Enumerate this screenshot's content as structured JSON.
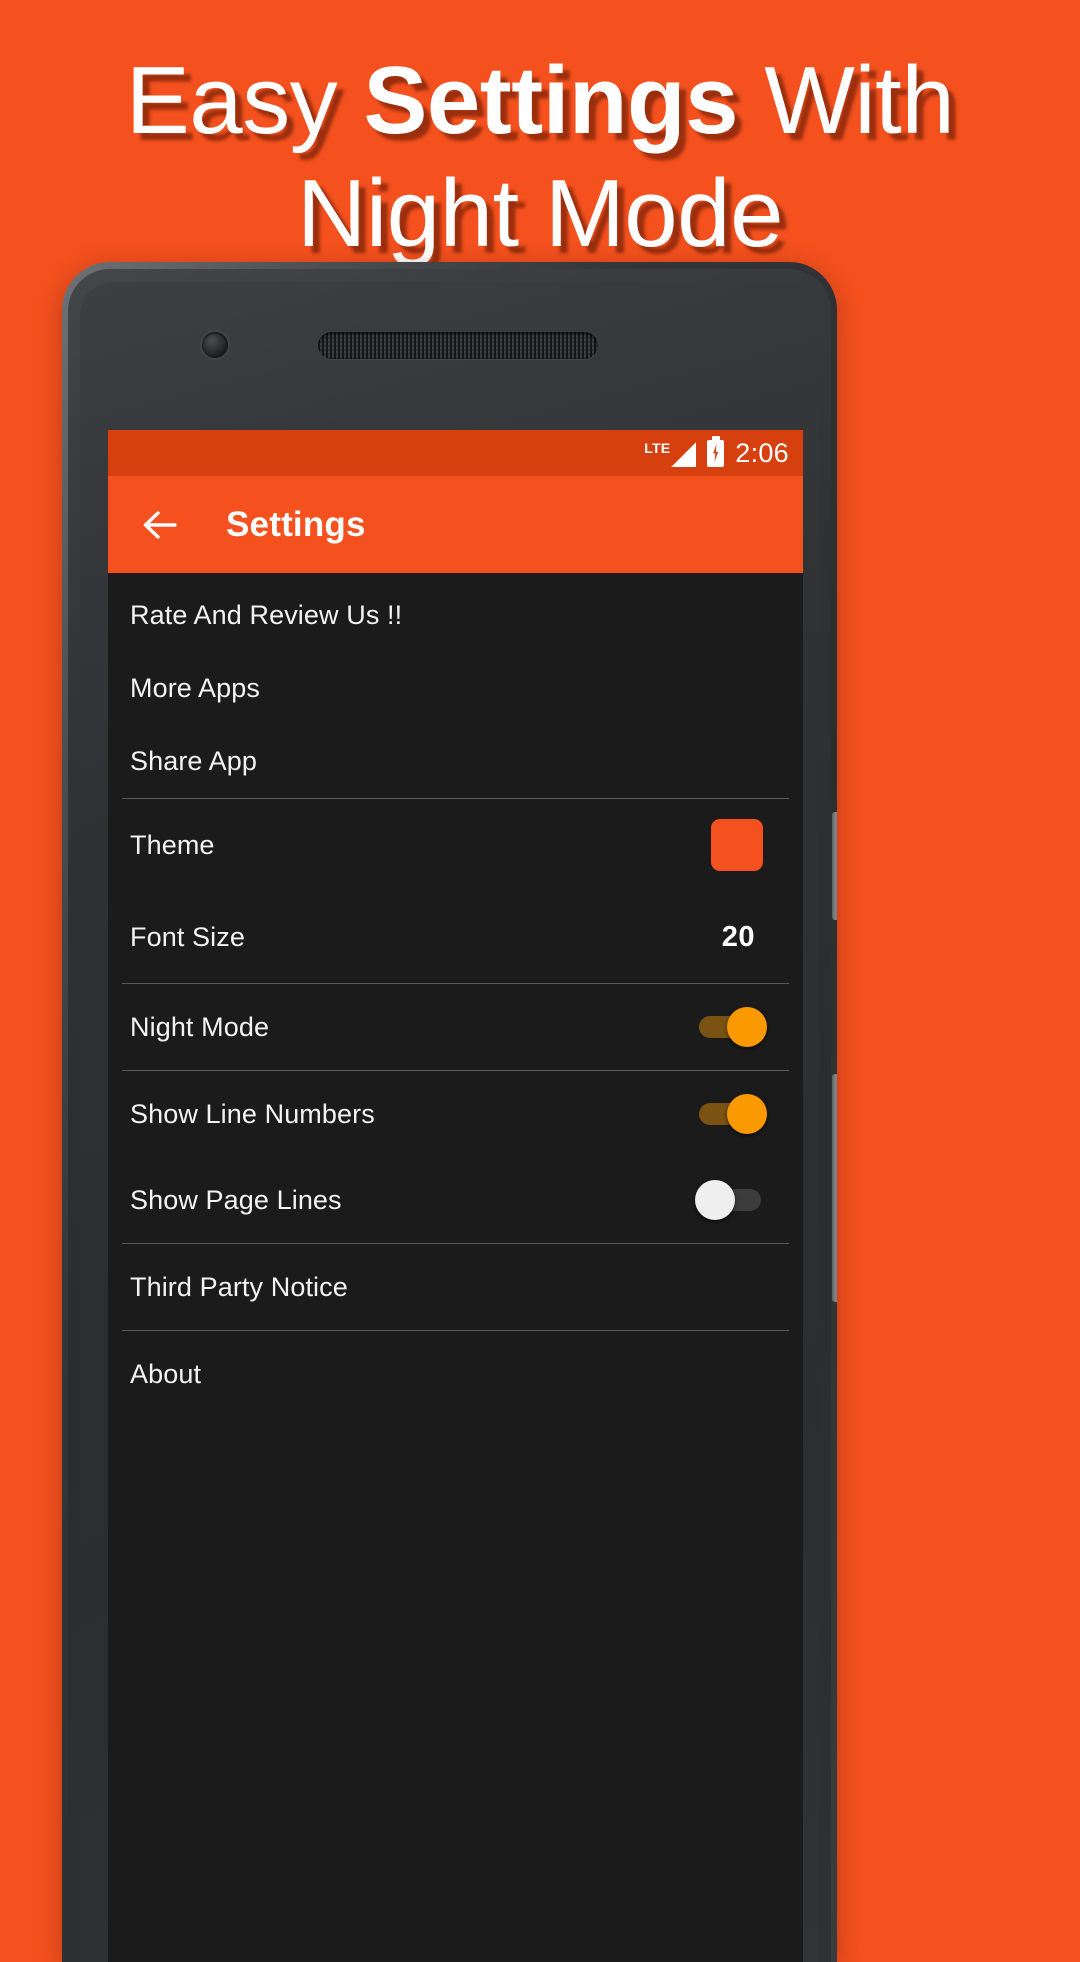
{
  "promo": {
    "headline_line1_part1": "Easy ",
    "headline_line1_bold": "Settings",
    "headline_line1_part2": " With",
    "headline_line2": "Night Mode",
    "background_color": "#F4511E"
  },
  "device": {
    "frame_color": "#303234",
    "power_button": "power-button",
    "volume_button": "volume-rocker",
    "front_camera": "front-camera",
    "earpiece": "earpiece-speaker"
  },
  "statusbar": {
    "network": "LTE",
    "signal_icon": "signal-bars-icon",
    "battery_icon": "battery-charging-icon",
    "time": "2:06",
    "background_color": "#D6400F"
  },
  "toolbar": {
    "back_icon": "back-arrow-icon",
    "title": "Settings",
    "background_color": "#F4511E"
  },
  "settings": {
    "items": [
      {
        "key": "rate",
        "label": "Rate And Review Us !!",
        "control": "none"
      },
      {
        "key": "more_apps",
        "label": "More Apps",
        "control": "none"
      },
      {
        "key": "share_app",
        "label": "Share App",
        "control": "none"
      },
      {
        "key": "theme",
        "label": "Theme",
        "control": "color-swatch",
        "value": "#F4511E"
      },
      {
        "key": "font_size",
        "label": "Font Size",
        "control": "value",
        "value": "20"
      },
      {
        "key": "night_mode",
        "label": "Night Mode",
        "control": "switch",
        "value": "on"
      },
      {
        "key": "line_numbers",
        "label": "Show Line Numbers",
        "control": "switch",
        "value": "on"
      },
      {
        "key": "page_lines",
        "label": "Show Page Lines",
        "control": "switch",
        "value": "off"
      },
      {
        "key": "third_party",
        "label": "Third Party Notice",
        "control": "none"
      },
      {
        "key": "about",
        "label": "About",
        "control": "none"
      }
    ],
    "switch_on_thumb_color": "#FB9900",
    "switch_on_track_color": "#7A5312",
    "switch_off_thumb_color": "#EFEFEF",
    "switch_off_track_color": "#3C3C3C",
    "background_color": "#1B1B1B",
    "divider_color": "#5A5A5A"
  }
}
